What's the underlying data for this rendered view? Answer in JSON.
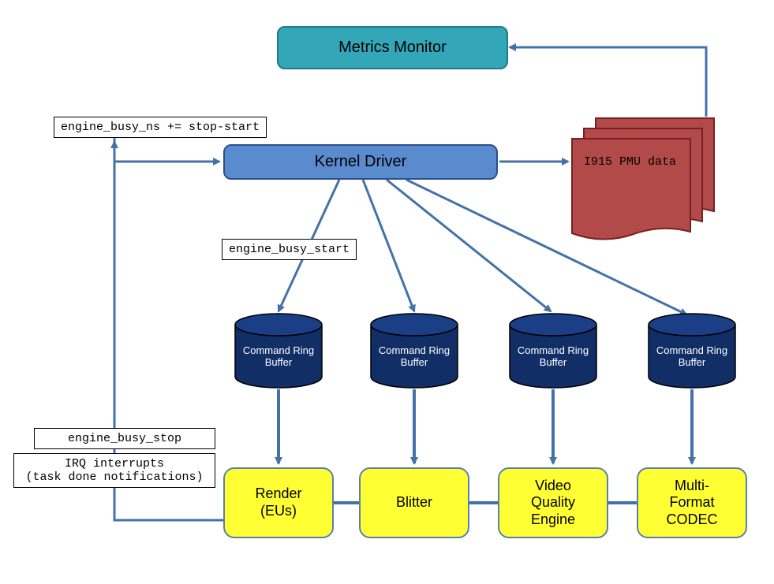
{
  "monitor": {
    "label": "Metrics Monitor"
  },
  "driver": {
    "label": "Kernel Driver"
  },
  "pmu": {
    "label": "I915 PMU data"
  },
  "notes": {
    "busy_ns": "engine_busy_ns += stop-start",
    "busy_start": "engine_busy_start",
    "busy_stop": "engine_busy_stop",
    "irq": "IRQ interrupts\n(task done notifications)"
  },
  "cylinder_label": "Command\nRing Buffer",
  "engines": {
    "render": "Render\n(EUs)",
    "blitter": "Blitter",
    "vqe": "Video\nQuality\nEngine",
    "codec": "Multi-\nFormat\nCODEC"
  },
  "colors": {
    "arrow": "#4472a8",
    "cylFill": "#112e66",
    "cylTop": "#1a3f87",
    "cylEdge": "#000000",
    "docFill": "#b34a4a",
    "docEdge": "#7a1f1f"
  }
}
